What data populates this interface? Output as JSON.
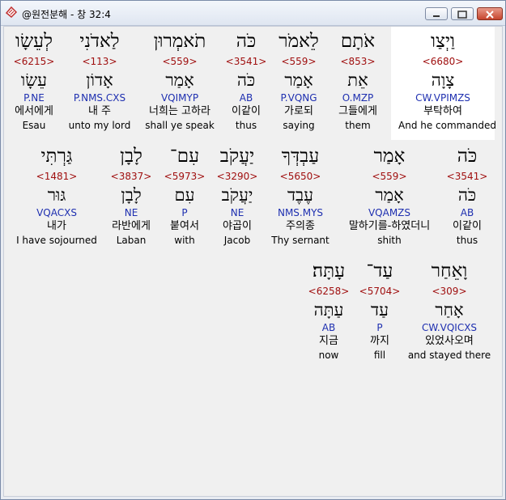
{
  "window": {
    "title": "@원전분해 - 창 32:4"
  },
  "rows": [
    [
      {
        "heb": "וַיְצַו",
        "num": "<6680>",
        "lemma": "צָוָה",
        "parse": "CW.VPIMZS",
        "kor": "부탁하여",
        "eng": "And he commanded"
      },
      {
        "heb": "אֹתָם",
        "num": "<853>",
        "lemma": "אֵת",
        "parse": "O.MZP",
        "kor": "그들에게",
        "eng": "them"
      },
      {
        "heb": "לֵאמֹר",
        "num": "<559>",
        "lemma": "אָמַר",
        "parse": "P.VQNG",
        "kor": "가로되",
        "eng": "saying"
      },
      {
        "heb": "כֹּה",
        "num": "<3541>",
        "lemma": "כֹּה",
        "parse": "AB",
        "kor": "이같이",
        "eng": "thus"
      },
      {
        "heb": "תֹאמְרוּן",
        "num": "<559>",
        "lemma": "אָמַר",
        "parse": "VQIMYP",
        "kor": "너희는 고하라",
        "eng": "shall ye speak"
      },
      {
        "heb": "לַאדֹנִי",
        "num": "<113>",
        "lemma": "אָדוֹן",
        "parse": "P.NMS.CXS",
        "kor": "내 주",
        "eng": "unto my lord"
      },
      {
        "heb": "לְעֵשָׂו",
        "num": "<6215>",
        "lemma": "עֵשָׂו",
        "parse": "P.NE",
        "kor": "에서에게",
        "eng": "Esau"
      }
    ],
    [
      {
        "heb": "כֹּה",
        "num": "<3541>",
        "lemma": "כֹּה",
        "parse": "AB",
        "kor": "이같이",
        "eng": "thus"
      },
      {
        "heb": "אָמַר",
        "num": "<559>",
        "lemma": "אָמַר",
        "parse": "VQAMZS",
        "kor": "말하기를-하였더니",
        "eng": "shith"
      },
      {
        "heb": "עַבְדְּךָ",
        "num": "<5650>",
        "lemma": "עֶבֶד",
        "parse": "NMS.MYS",
        "kor": "주의종",
        "eng": "Thy sernant"
      },
      {
        "heb": "יַעֲקֹב",
        "num": "<3290>",
        "lemma": "יַעֲקֹב",
        "parse": "NE",
        "kor": "야곱이",
        "eng": "Jacob"
      },
      {
        "heb": "עִם־",
        "num": "<5973>",
        "lemma": "עִם",
        "parse": "P",
        "kor": "붙여서",
        "eng": "with"
      },
      {
        "heb": "לָבָן",
        "num": "<3837>",
        "lemma": "לָבָן",
        "parse": "NE",
        "kor": "라반에게",
        "eng": "Laban"
      },
      {
        "heb": "גַּרְתִּי",
        "num": "<1481>",
        "lemma": "גּוּר",
        "parse": "VQACXS",
        "kor": "내가",
        "eng": "I have sojourned"
      }
    ],
    [
      {
        "heb": "וָאֵחַר",
        "num": "<309>",
        "lemma": "אָחַר",
        "parse": "CW.VQICXS",
        "kor": "있었사오며",
        "eng": "and stayed there"
      },
      {
        "heb": "עַד־",
        "num": "<5704>",
        "lemma": "עַד",
        "parse": "P",
        "kor": "까지",
        "eng": "fill"
      },
      {
        "heb": "עָתָּה׃",
        "num": "<6258>",
        "lemma": "עַתָּה",
        "parse": "AB",
        "kor": "지금",
        "eng": "now"
      }
    ]
  ],
  "colors": {
    "number": "#a01010",
    "parse": "#1e2fb0",
    "highlight": "#ffffff"
  }
}
